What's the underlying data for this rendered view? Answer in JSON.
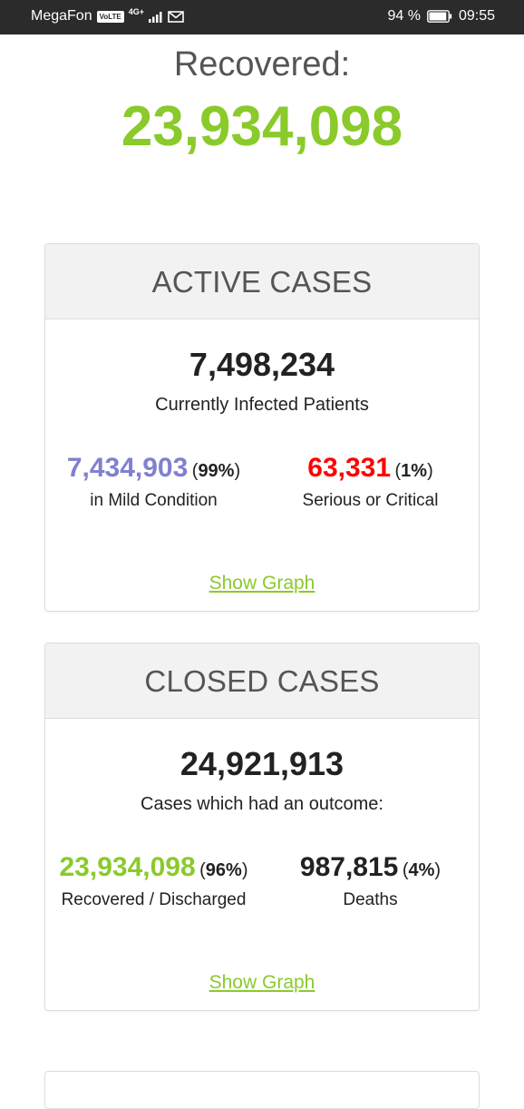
{
  "status_bar": {
    "carrier": "MegaFon",
    "volte": "VoLTE",
    "network": "4G+",
    "battery_pct": "94 %",
    "battery_level": 0.94,
    "time": "09:55"
  },
  "recovered": {
    "label": "Recovered:",
    "value": "23,934,098",
    "color": "#8ACA2B"
  },
  "active_cases": {
    "title": "ACTIVE CASES",
    "total": "7,498,234",
    "subtitle": "Currently Infected Patients",
    "mild": {
      "value": "7,434,903",
      "pct": "99%",
      "label": "in Mild Condition",
      "color": "#8080cf"
    },
    "serious": {
      "value": "63,331",
      "pct": "1%",
      "label": "Serious or Critical",
      "color": "#ff0000"
    },
    "link": "Show Graph"
  },
  "closed_cases": {
    "title": "CLOSED CASES",
    "total": "24,921,913",
    "subtitle": "Cases which had an outcome:",
    "recovered": {
      "value": "23,934,098",
      "pct": "96%",
      "label": "Recovered / Discharged",
      "color": "#8ACA2B"
    },
    "deaths": {
      "value": "987,815",
      "pct": "4%",
      "label": "Deaths",
      "color": "#222222"
    },
    "link": "Show Graph"
  }
}
